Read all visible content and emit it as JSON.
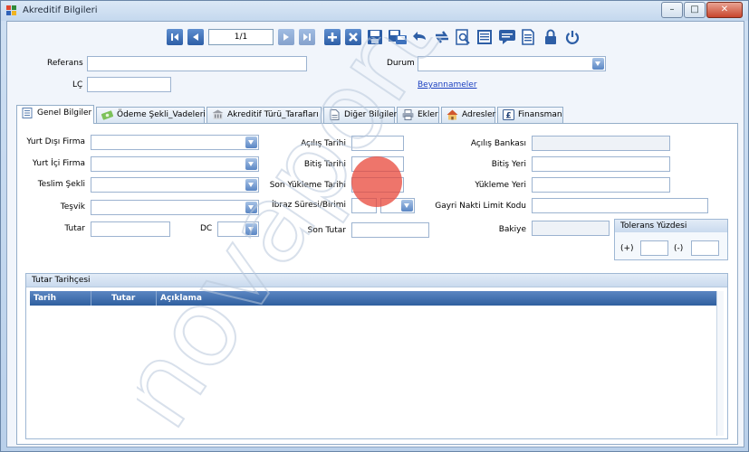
{
  "window": {
    "title": "Akreditif Bilgileri",
    "controls": {
      "minimize": "–",
      "maximize": "□",
      "close": "✕"
    }
  },
  "toolbar": {
    "pager_value": "1/1"
  },
  "header": {
    "referans_label": "Referans",
    "referans_value": "",
    "lc_label": "LÇ",
    "lc_value": "",
    "durum_label": "Durum",
    "durum_value": "",
    "beyanname_link": "Beyannameler"
  },
  "tabs": [
    {
      "label": "Genel Bilgiler",
      "icon": "document-icon"
    },
    {
      "label": "Ödeme Şekli_Vadeleri",
      "icon": "money-icon"
    },
    {
      "label": "Akreditif Türü_Tarafları",
      "icon": "building-icon"
    },
    {
      "label": "Diğer Bilgiler",
      "icon": "page-icon"
    },
    {
      "label": "Ekler",
      "icon": "printer-icon"
    },
    {
      "label": "Adresler",
      "icon": "house-icon"
    },
    {
      "label": "Finansman",
      "icon": "pound-icon"
    }
  ],
  "form": {
    "yurt_disi_firma": "Yurt Dışı Firma",
    "yurt_ici_firma": "Yurt İçi Firma",
    "teslim_sekli": "Teslim Şekli",
    "tesvik": "Teşvik",
    "tutar": "Tutar",
    "dc": "DC",
    "acilis_tarihi": "Açılış Tarihi",
    "bitis_tarihi": "Bitiş Tarihi",
    "son_yukleme_tarihi": "Son Yükleme Tarihi",
    "ibraz_suresi": "İbraz Süresi/Birimi",
    "son_tutar": "Son Tutar",
    "acilis_bankasi": "Açılış Bankası",
    "bitis_yeri": "Bitiş Yeri",
    "yukleme_yeri": "Yükleme Yeri",
    "gayri_nakti_limit_kodu": "Gayri Nakti Limit Kodu",
    "bakiye": "Bakiye"
  },
  "tolerans": {
    "title": "Tolerans Yüzdesi",
    "plus_label": "(+)",
    "minus_label": "(-)"
  },
  "history": {
    "title": "Tutar Tarihçesi",
    "columns": [
      "Tarih",
      "Tutar",
      "Açıklama"
    ]
  },
  "watermark": {
    "text": "novaportus"
  },
  "colors": {
    "accent": "#2d5ea6",
    "link": "#1a3fc0",
    "panel": "#ffffff",
    "watermark_dot": "#e8473a"
  }
}
